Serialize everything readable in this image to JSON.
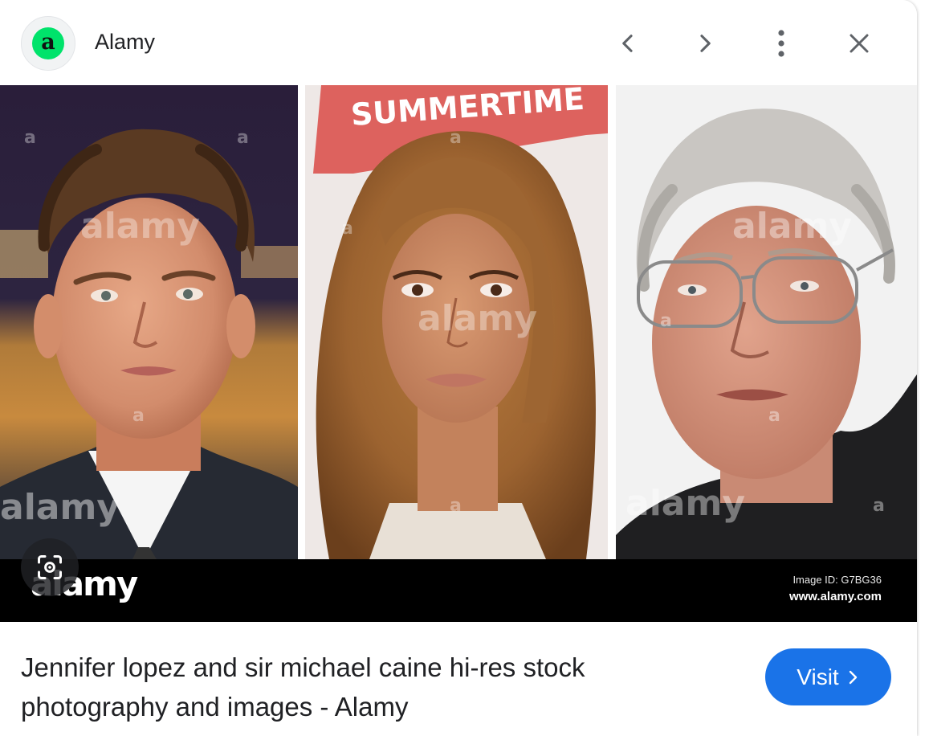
{
  "header": {
    "site_icon_letter": "a",
    "site_icon_color": "#00e36b",
    "site_name": "Alamy",
    "icons": {
      "previous": "chevron-left-icon",
      "next": "chevron-right-icon",
      "more": "more-vert-icon",
      "close": "close-icon"
    }
  },
  "image": {
    "watermark": "alamy",
    "watermark_letter": "a",
    "banner_text_photo_2": "SUMMERTIME",
    "band_logo": "alamy",
    "image_id": "Image ID: G7BG36",
    "url": "www.alamy.com",
    "lens_icon": "image-search-icon"
  },
  "result": {
    "title": "Jennifer lopez and sir michael caine hi-res stock photography and images - Alamy",
    "visit_label": "Visit",
    "visit_color": "#1a73e8"
  }
}
